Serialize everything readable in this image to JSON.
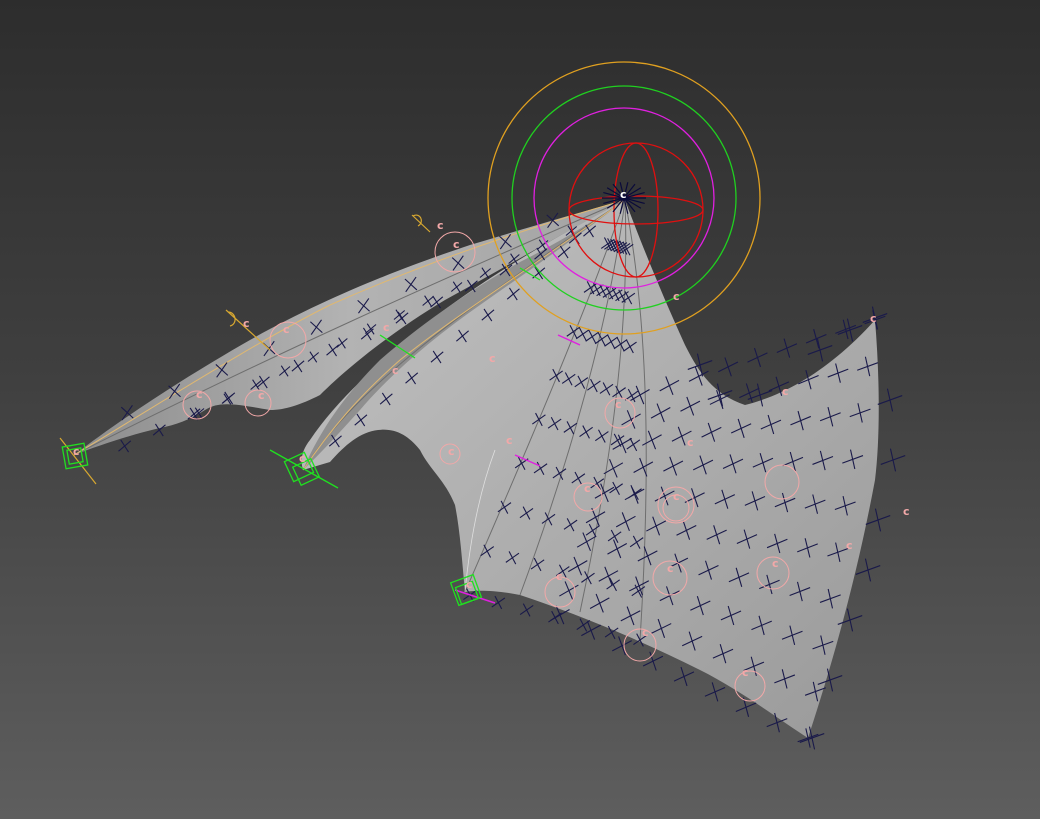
{
  "viewport": {
    "background_top": "#2d2d2d",
    "background_bottom": "#5e5e5e"
  },
  "mesh": {
    "surface_color": "#a9a9a9",
    "crease_color": "#6e6e6e",
    "cross_marker_color": "#1a1a4a",
    "edge_highlight_color": "#e0b870"
  },
  "constraint_label": "c",
  "colors": {
    "helper_pink": "#f2a8a8",
    "gizmo_x": "#e01010",
    "gizmo_view": "#e020e0",
    "gizmo_screen": "#20d020",
    "gizmo_outer": "#e0a020",
    "anchor_green": "#20e020"
  }
}
